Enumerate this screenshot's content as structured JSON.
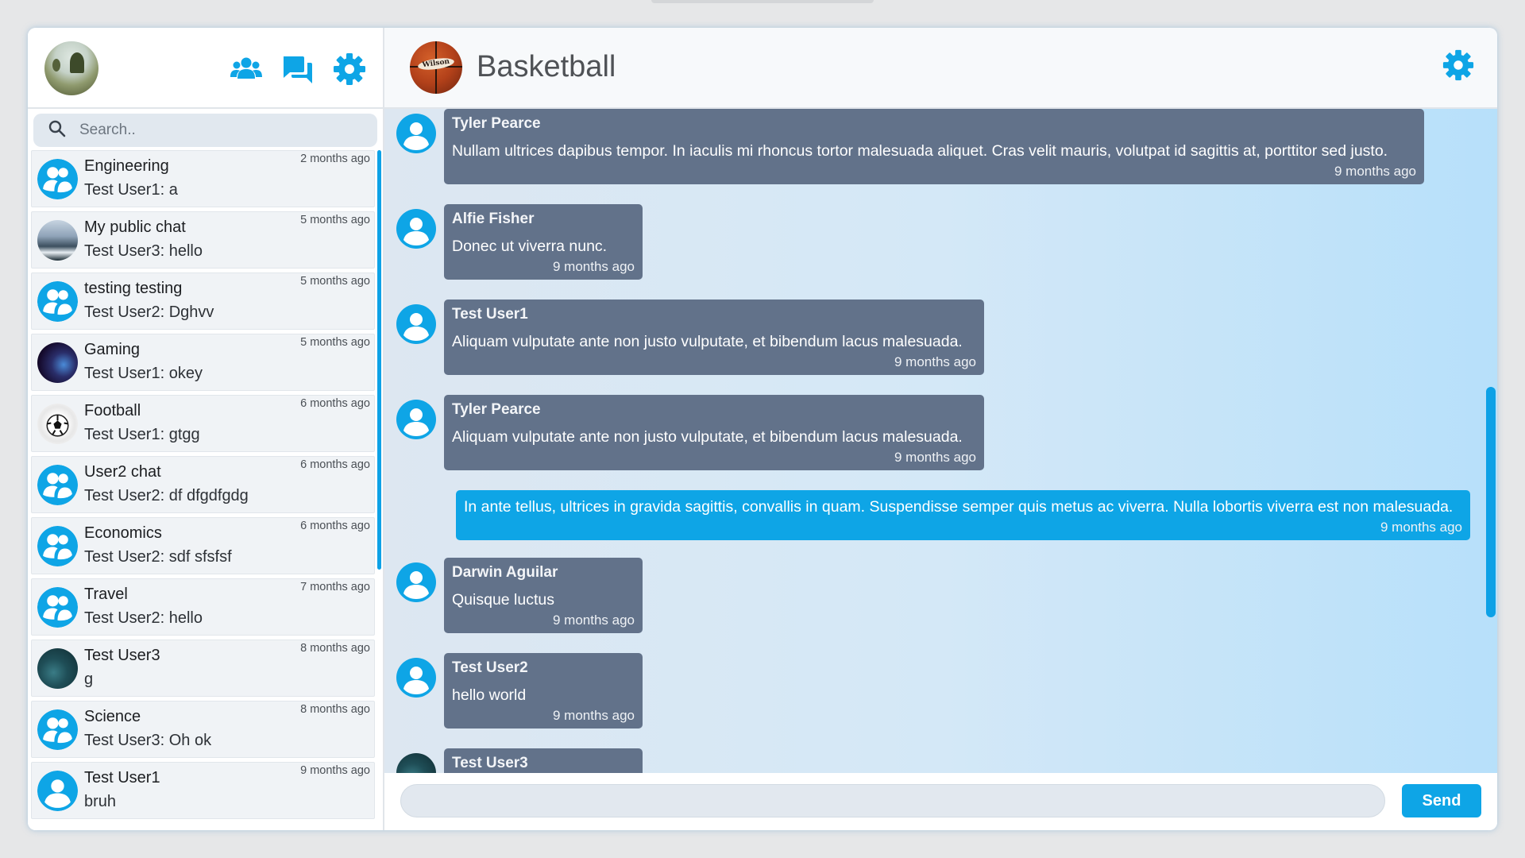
{
  "sidebar": {
    "icons": [
      "users-icon",
      "chat-bubbles-icon",
      "gear-icon"
    ],
    "search": {
      "placeholder": "Search.."
    },
    "chats": [
      {
        "name": "Engineering",
        "sender": "Test User1:",
        "last": "a",
        "time": "2 months ago",
        "avatar": "group"
      },
      {
        "name": "My public chat",
        "sender": "Test User3:",
        "last": "hello",
        "time": "5 months ago",
        "avatar": "photo-waves"
      },
      {
        "name": "testing testing",
        "sender": "Test User2:",
        "last": "Dghvv",
        "time": "5 months ago",
        "avatar": "group"
      },
      {
        "name": "Gaming",
        "sender": "Test User1:",
        "last": "okey",
        "time": "5 months ago",
        "avatar": "photo-gaming"
      },
      {
        "name": "Football",
        "sender": "Test User1:",
        "last": "gtgg",
        "time": "6 months ago",
        "avatar": "photo-football"
      },
      {
        "name": "User2 chat",
        "sender": "Test User2:",
        "last": "df dfgdfgdg",
        "time": "6 months ago",
        "avatar": "group"
      },
      {
        "name": "Economics",
        "sender": "Test User2:",
        "last": "sdf sfsfsf",
        "time": "6 months ago",
        "avatar": "group"
      },
      {
        "name": "Travel",
        "sender": "Test User2:",
        "last": "hello",
        "time": "7 months ago",
        "avatar": "group"
      },
      {
        "name": "Test User3",
        "sender": "",
        "last": "g",
        "time": "8 months ago",
        "avatar": "photo-ocean"
      },
      {
        "name": "Science",
        "sender": "Test User3:",
        "last": "Oh ok",
        "time": "8 months ago",
        "avatar": "group"
      },
      {
        "name": "Test User1",
        "sender": "",
        "last": "bruh",
        "time": "9 months ago",
        "avatar": "user"
      }
    ]
  },
  "room": {
    "title": "Basketball",
    "avatar_brand": "Wilson",
    "gear_icon": "gear-icon"
  },
  "messages": [
    {
      "sender": "Tyler Pearce",
      "text": "Nullam ultrices dapibus tempor. In iaculis mi rhoncus tortor malesuada aliquet. Cras velit mauris, volutpat id sagittis at, porttitor sed justo.",
      "time": "9 months ago",
      "own": false,
      "avatar": "user"
    },
    {
      "sender": "Alfie Fisher",
      "text": "Donec ut viverra nunc.",
      "time": "9 months ago",
      "own": false,
      "avatar": "user"
    },
    {
      "sender": "Test User1",
      "text": "Aliquam vulputate ante non justo vulputate, et bibendum lacus malesuada.",
      "time": "9 months ago",
      "own": false,
      "avatar": "user"
    },
    {
      "sender": "Tyler Pearce",
      "text": "Aliquam vulputate ante non justo vulputate, et bibendum lacus malesuada.",
      "time": "9 months ago",
      "own": false,
      "avatar": "user"
    },
    {
      "sender": "",
      "text": "In ante tellus, ultrices in gravida sagittis, convallis in quam. Suspendisse semper quis metus ac viverra. Nulla lobortis viverra est non malesuada.",
      "time": "9 months ago",
      "own": true,
      "avatar": ""
    },
    {
      "sender": "Darwin Aguilar",
      "text": "Quisque luctus",
      "time": "9 months ago",
      "own": false,
      "avatar": "user"
    },
    {
      "sender": "Test User2",
      "text": "hello world",
      "time": "9 months ago",
      "own": false,
      "avatar": "user"
    },
    {
      "sender": "Test User3",
      "text": "",
      "time": "",
      "own": false,
      "avatar": "photo-ocean"
    }
  ],
  "composer": {
    "placeholder": "",
    "value": "",
    "send_label": "Send"
  },
  "colors": {
    "accent": "#0ea5e6",
    "bubble": "#62728a",
    "chat_item_bg": "#f0f3f6"
  }
}
